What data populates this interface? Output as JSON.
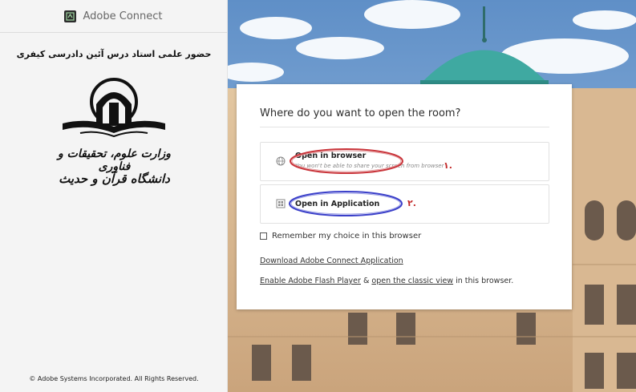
{
  "brand": {
    "name": "Adobe Connect",
    "logo_icon": "adobe-connect-logo-icon"
  },
  "meeting": {
    "title": "حضور علمی استاد درس آئین دادرسی کیفری"
  },
  "university_logo": {
    "line1": "وزارت علوم، تحقیقات و فناوری",
    "line2": "دانشگاه قرآن و حدیث"
  },
  "footer": {
    "copyright": "© Adobe Systems Incorporated. All Rights Reserved."
  },
  "dialog": {
    "title": "Where do you want to open the room?",
    "options": [
      {
        "label": "Open in browser",
        "sublabel": "You won't be able to share your screen from browser",
        "icon": "globe-icon",
        "annotation": "۱.",
        "highlight_color": "#c9343a"
      },
      {
        "label": "Open in Application",
        "icon": "app-grid-icon",
        "annotation": "۲.",
        "highlight_color": "#3a3fc9"
      }
    ],
    "remember": {
      "label": "Remember my choice in this browser",
      "checked": false
    },
    "download_link": "Download Adobe Connect Application",
    "flash_line": {
      "link1": "Enable Adobe Flash Player",
      "sep": " & ",
      "link2": "open the classic view",
      "suffix": " in this browser."
    }
  },
  "colors": {
    "sky": "#6e9bd0",
    "dome": "#3eaaa0",
    "building": "#d6b48c"
  }
}
